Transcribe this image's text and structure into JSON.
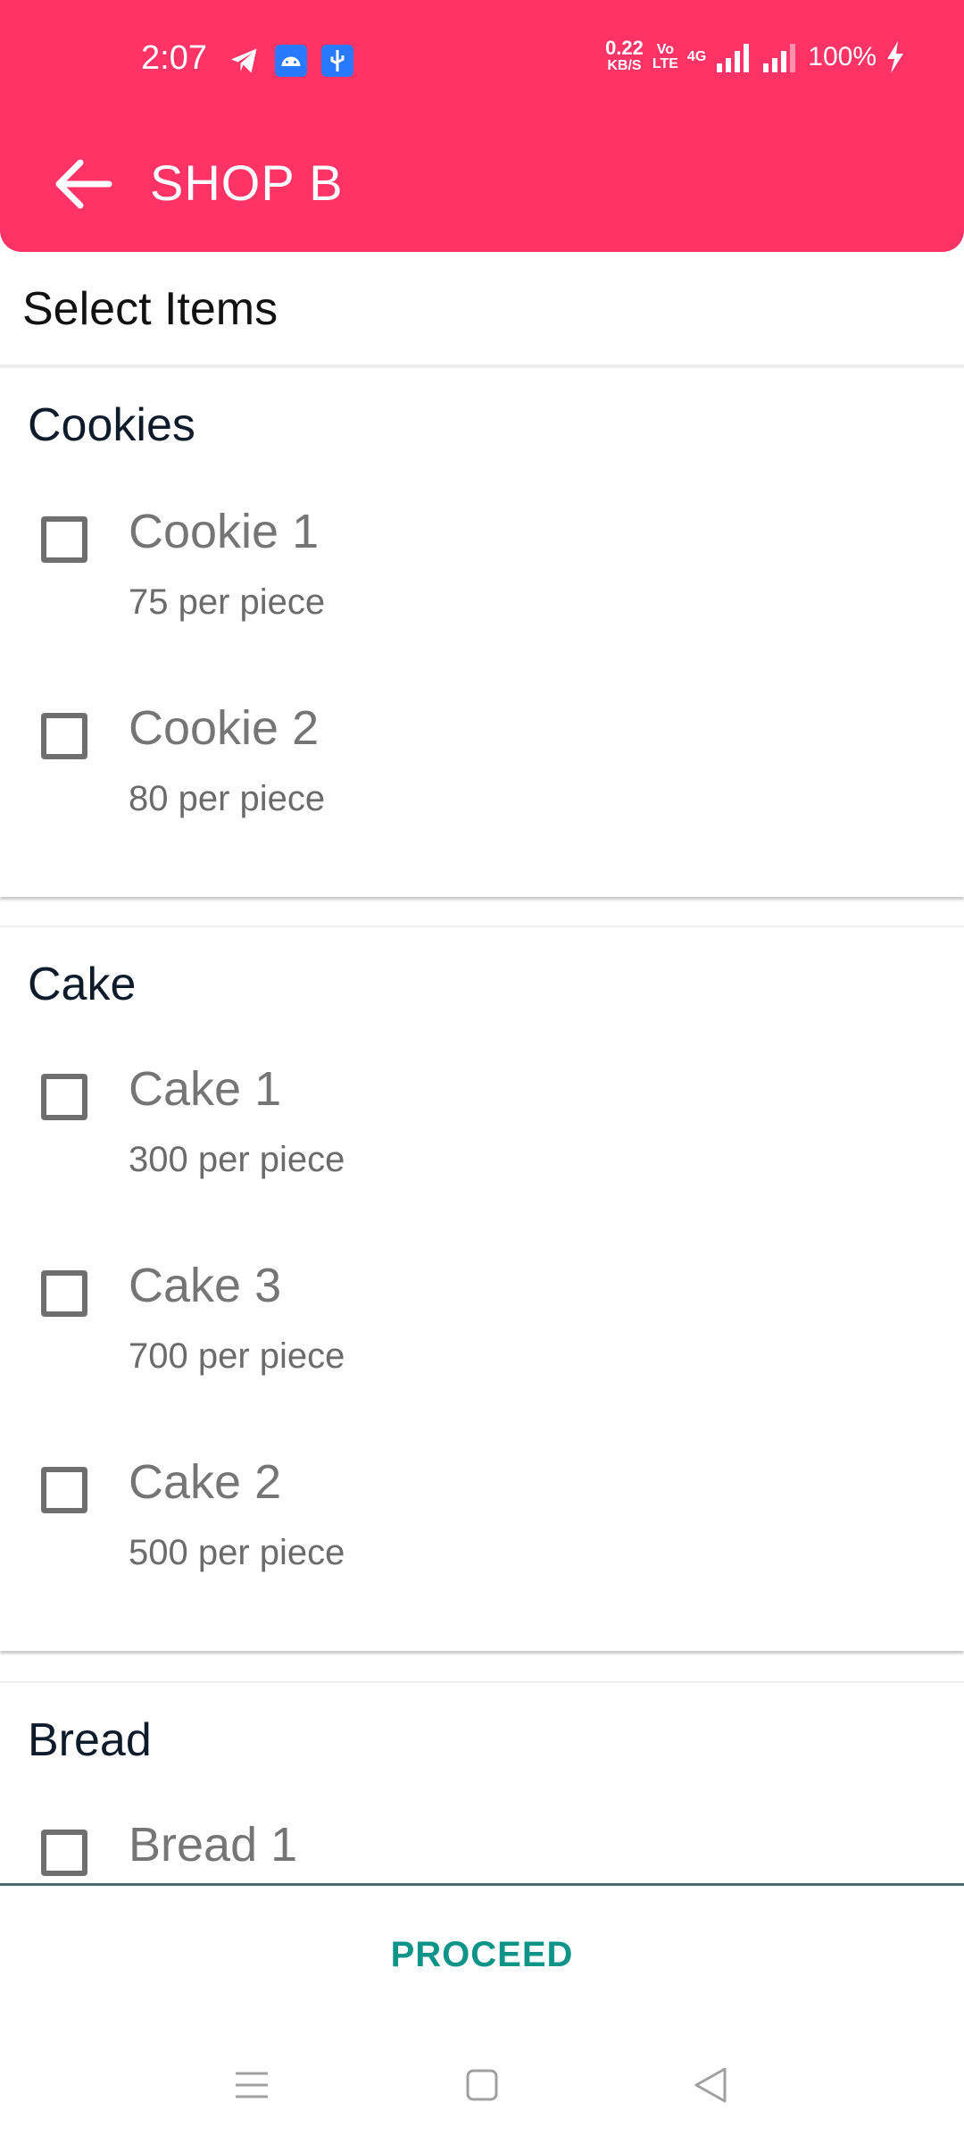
{
  "status_bar": {
    "time": "2:07",
    "net_speed": "0.22",
    "net_unit": "KB/S",
    "volte_top": "Vo",
    "volte_bottom": "LTE",
    "network": "4G",
    "battery": "100%"
  },
  "app_bar": {
    "title": "SHOP B",
    "color": "#FF3366"
  },
  "page": {
    "heading": "Select Items"
  },
  "categories": [
    {
      "name": "Cookies",
      "items": [
        {
          "name": "Cookie 1",
          "price": "75 per piece",
          "checked": false
        },
        {
          "name": "Cookie 2",
          "price": "80 per piece",
          "checked": false
        }
      ]
    },
    {
      "name": "Cake",
      "items": [
        {
          "name": "Cake 1",
          "price": "300 per piece",
          "checked": false
        },
        {
          "name": "Cake 3",
          "price": "700 per piece",
          "checked": false
        },
        {
          "name": "Cake 2",
          "price": "500 per piece",
          "checked": false
        }
      ]
    },
    {
      "name": "Bread",
      "items": [
        {
          "name": "Bread 1",
          "checked": false
        }
      ]
    }
  ],
  "footer": {
    "proceed_label": "PROCEED",
    "proceed_color": "#0D9488"
  },
  "icons": {
    "back": "arrow-left-icon",
    "nav_menu": "menu-icon",
    "nav_home": "square-home-icon",
    "nav_back": "triangle-back-icon"
  }
}
